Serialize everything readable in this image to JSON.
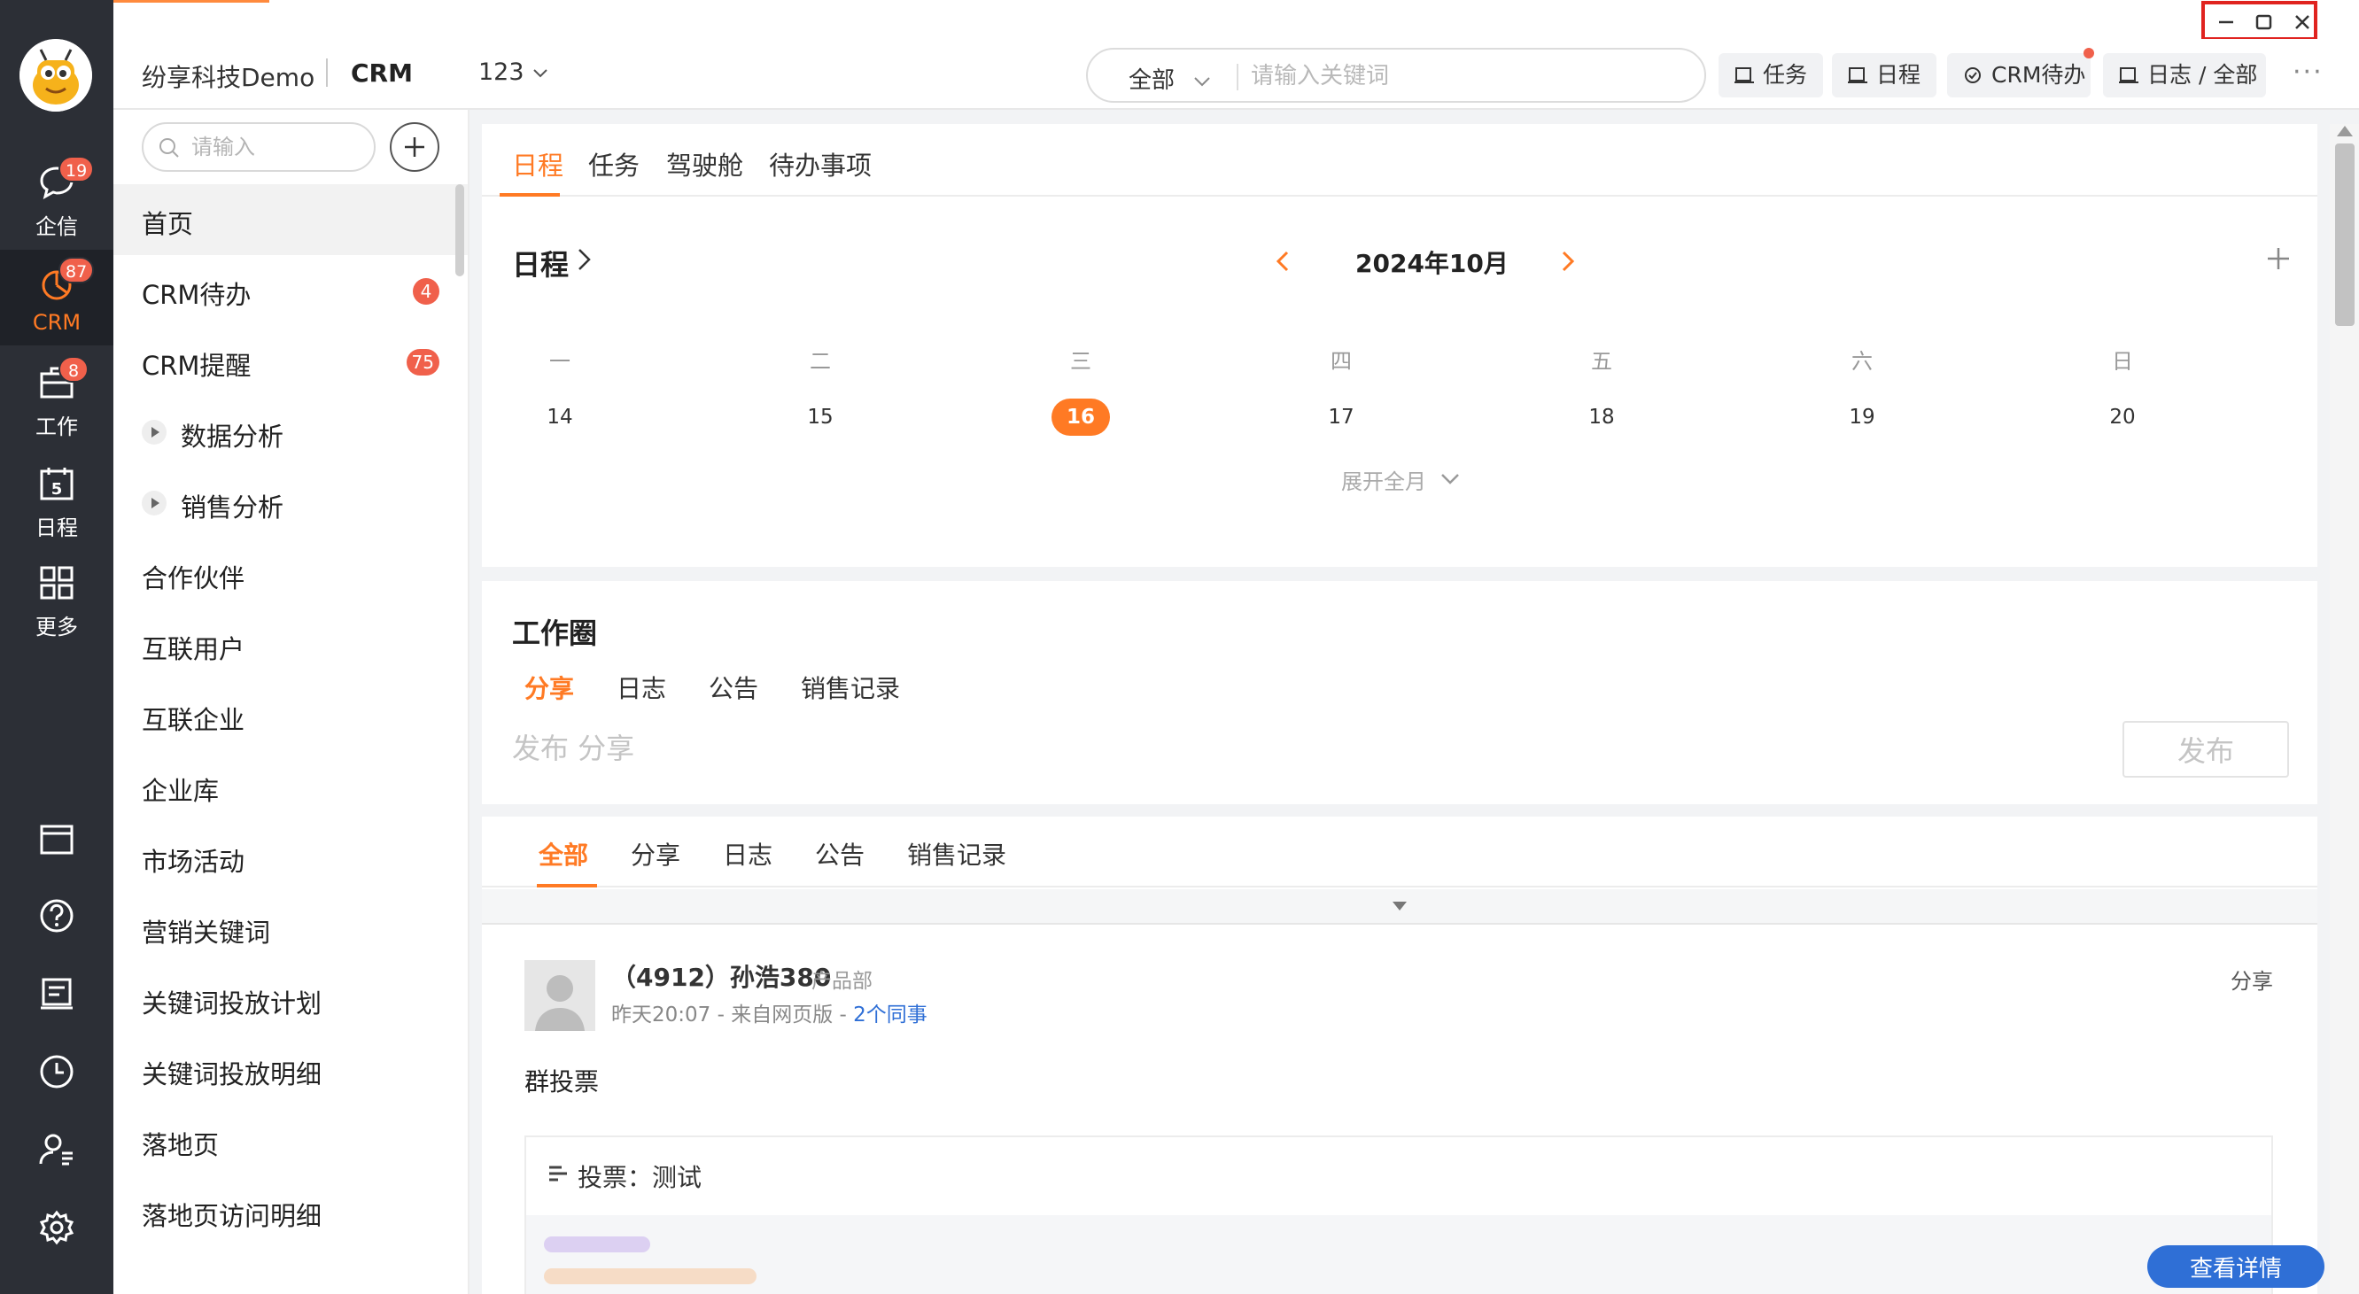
{
  "rail": {
    "items": [
      {
        "label": "企信",
        "badge": "19"
      },
      {
        "label": "CRM",
        "badge": "87"
      },
      {
        "label": "工作",
        "badge": "8"
      },
      {
        "label": "日程",
        "badge": ""
      },
      {
        "label": "更多",
        "badge": ""
      }
    ],
    "calendar_icon_day": "5"
  },
  "header": {
    "company": "纷享科技Demo",
    "app": "CRM",
    "workspace": "123",
    "search": {
      "scope": "全部",
      "placeholder": "请输入关键词"
    },
    "buttons": {
      "task": "任务",
      "schedule": "日程",
      "crm_todo": "CRM待办",
      "log": "日志 / 全部"
    },
    "more": "···"
  },
  "leftnav": {
    "search_placeholder": "请输入",
    "items": [
      {
        "label": "首页",
        "badge": ""
      },
      {
        "label": "CRM待办",
        "badge": "4"
      },
      {
        "label": "CRM提醒",
        "badge": "75"
      },
      {
        "label": "数据分析",
        "badge": ""
      },
      {
        "label": "销售分析",
        "badge": ""
      },
      {
        "label": "合作伙伴",
        "badge": ""
      },
      {
        "label": "互联用户",
        "badge": ""
      },
      {
        "label": "互联企业",
        "badge": ""
      },
      {
        "label": "企业库",
        "badge": ""
      },
      {
        "label": "市场活动",
        "badge": ""
      },
      {
        "label": "营销关键词",
        "badge": ""
      },
      {
        "label": "关键词投放计划",
        "badge": ""
      },
      {
        "label": "关键词投放明细",
        "badge": ""
      },
      {
        "label": "落地页",
        "badge": ""
      },
      {
        "label": "落地页访问明细",
        "badge": ""
      }
    ]
  },
  "schedule": {
    "tabs": [
      "日程",
      "任务",
      "驾驶舱",
      "待办事项"
    ],
    "title": "日程",
    "month": "2024年10月",
    "weekdays": [
      "一",
      "二",
      "三",
      "四",
      "五",
      "六",
      "日"
    ],
    "days": [
      "14",
      "15",
      "16",
      "17",
      "18",
      "19",
      "20"
    ],
    "expand": "展开全月"
  },
  "workcircle": {
    "title": "工作圈",
    "tabs": [
      "分享",
      "日志",
      "公告",
      "销售记录"
    ],
    "compose_placeholder": "发布 分享",
    "publish": "发布"
  },
  "feed": {
    "tabs": [
      "全部",
      "分享",
      "日志",
      "公告",
      "销售记录"
    ],
    "post": {
      "author": "（4912）孙浩380",
      "dept": "产品部",
      "meta": "昨天20:07 - 来自网页版 - ",
      "colleagues": "2个同事",
      "type": "分享",
      "body": "群投票",
      "vote_title": "投票：测试",
      "detail_button": "查看详情"
    }
  },
  "colors": {
    "accent": "#ff7a24",
    "badge": "#f0604b",
    "link": "#2f6fd6",
    "rail": "#2c2f36"
  }
}
